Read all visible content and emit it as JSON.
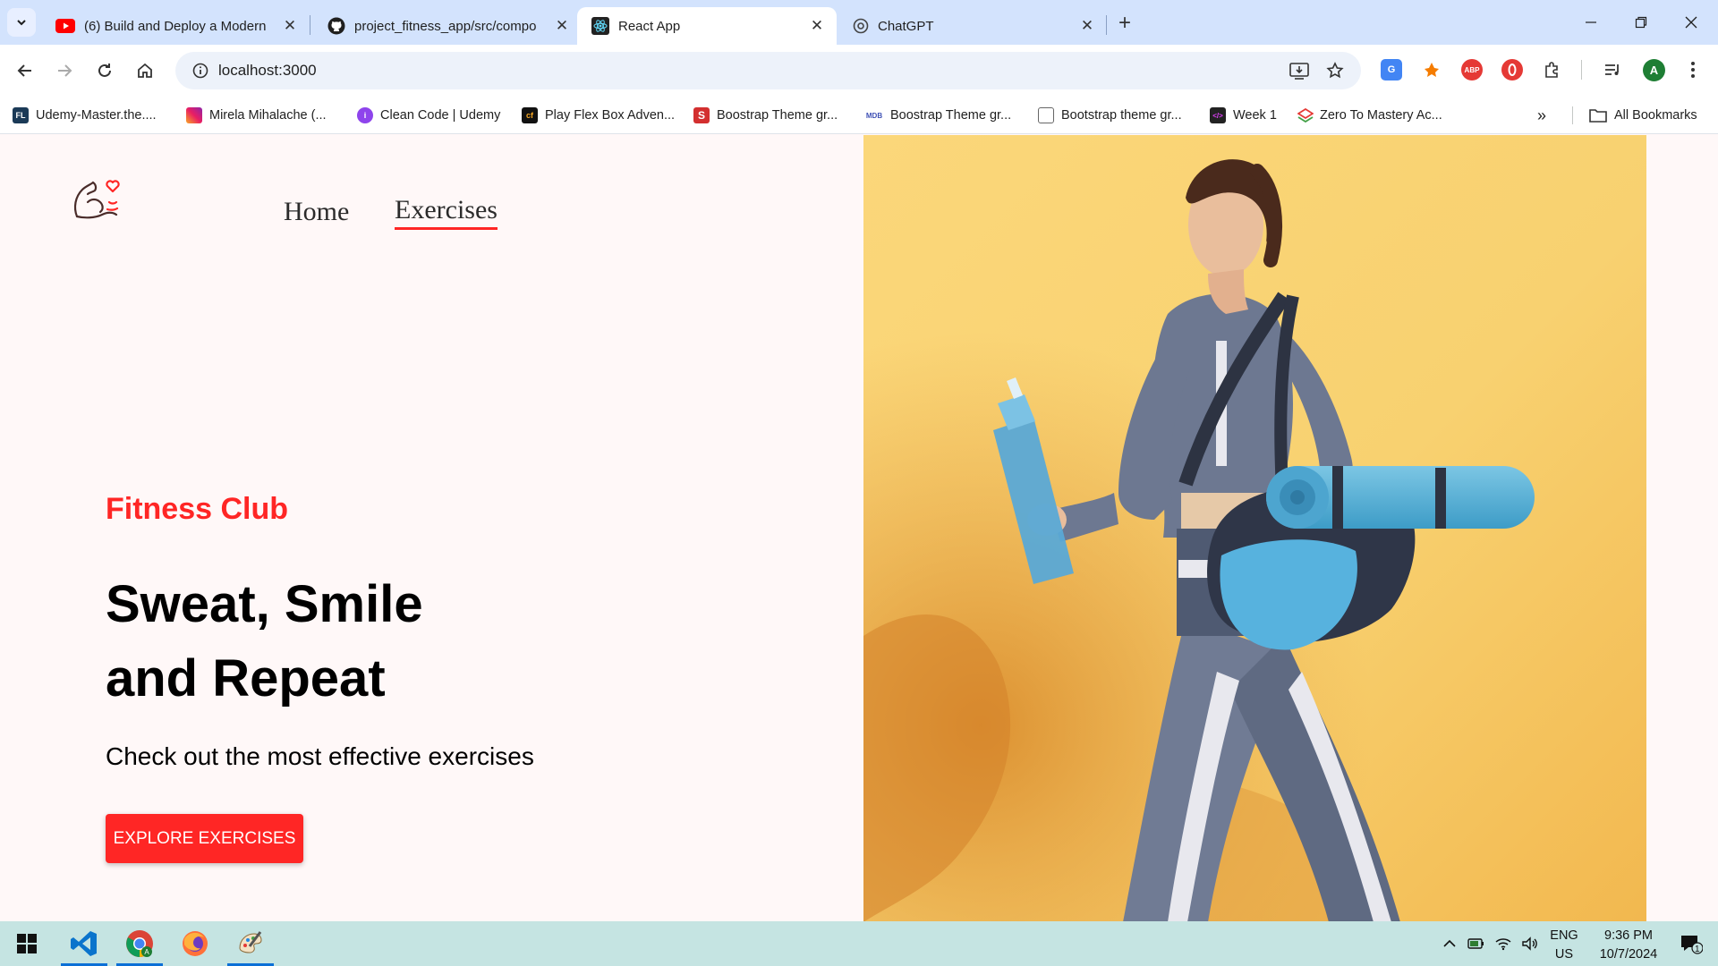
{
  "browser": {
    "tabs": [
      {
        "title": "(6) Build and Deploy a Modern",
        "icon": "youtube-icon",
        "active": false
      },
      {
        "title": "project_fitness_app/src/compo",
        "icon": "github-icon",
        "active": false
      },
      {
        "title": "React App",
        "icon": "react-icon",
        "active": true
      },
      {
        "title": "ChatGPT",
        "icon": "chatgpt-icon",
        "active": false
      }
    ],
    "url": "localhost:3000",
    "profile_initial": "A",
    "bookmarks": [
      {
        "label": "Udemy-Master.the....",
        "icon": "FL"
      },
      {
        "label": "Mirela Mihalache (...",
        "icon": "ig"
      },
      {
        "label": "Clean Code | Udemy",
        "icon": "i"
      },
      {
        "label": "Play Flex Box Adven...",
        "icon": "cf"
      },
      {
        "label": "Boostrap Theme gr...",
        "icon": "S"
      },
      {
        "label": "Boostrap Theme gr...",
        "icon": "MDB"
      },
      {
        "label": "Bootstrap theme gr...",
        "icon": "bs"
      },
      {
        "label": "Week 1",
        "icon": "</>"
      },
      {
        "label": "Zero To Mastery Ac...",
        "icon": "ztm"
      }
    ],
    "all_bookmarks_label": "All Bookmarks"
  },
  "page": {
    "nav": {
      "home": "Home",
      "exercises": "Exercises"
    },
    "tagline": "Fitness Club",
    "headline_line1": "Sweat, Smile",
    "headline_line2": "and Repeat",
    "subtext": "Check out the most effective exercises",
    "cta": "EXPLORE EXERCISES"
  },
  "taskbar": {
    "lang_line1": "ENG",
    "lang_line2": "US",
    "time": "9:36 PM",
    "date": "10/7/2024",
    "notification_count": "1"
  },
  "colors": {
    "accent": "#ff2625",
    "tabbar": "#d3e3fd",
    "page_bg": "#fff8f8",
    "taskbar": "#c5e4e2"
  }
}
